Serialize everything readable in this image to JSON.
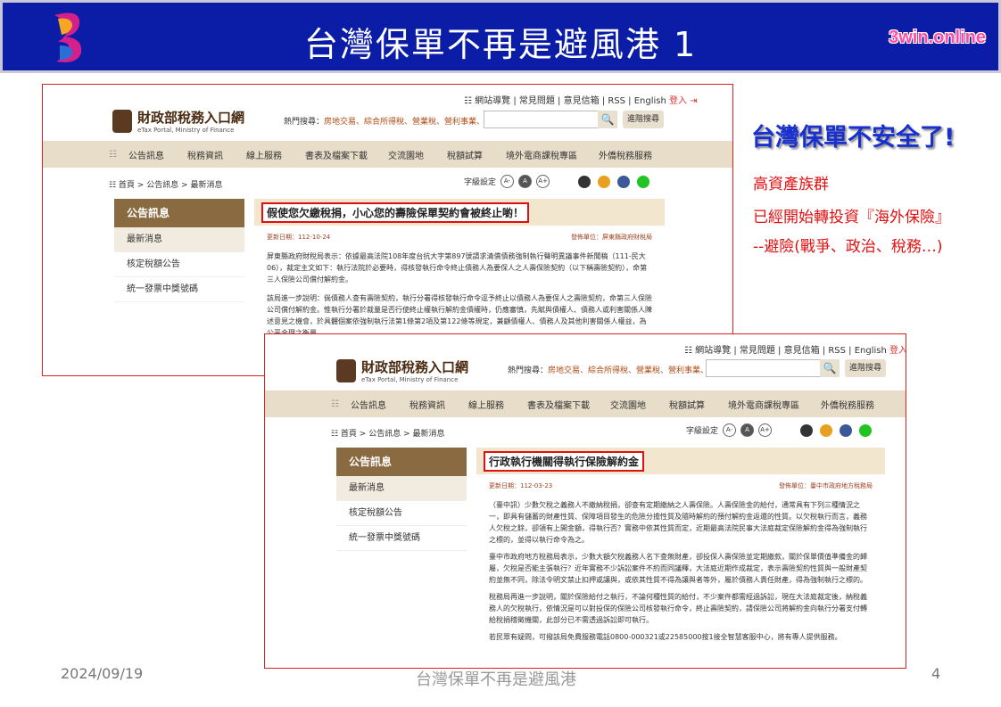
{
  "slide": {
    "title": "台灣保單不再是避風港 1",
    "brand": "3win.online",
    "side_heading": "台灣保單不安全了!",
    "side_lines": [
      "高資產族群",
      "已經開始轉投資『海外保險』",
      "--避險(戰爭、政治、稅務…)"
    ],
    "footer_date": "2024/09/19",
    "footer_title": "台灣保單不再是避風港",
    "footer_page": "4",
    "colors": {
      "banner": "#0b1da6",
      "heading": "#1830d0",
      "accent_red": "#e01010",
      "nav_bg": "#e8ddc8",
      "menu_head": "#8a6a40"
    }
  },
  "portal": {
    "topbar_text": "☷ 網站導覽 | 常見問題 | 意見信箱 | RSS | English ",
    "login": "登入 ⇥",
    "name": "財政部稅務入口網",
    "english_name": "eTax Portal, Ministry of Finance",
    "hot_label": "熱門搜尋：",
    "hot_keywords": "房地交易、綜合所得稅、營業稅、營利事業、退稅",
    "search_icon": "🔍",
    "advanced_search": "進階搜尋",
    "nav": [
      "公告訊息",
      "稅務資訊",
      "線上服務",
      "書表及檔案下載",
      "交流園地",
      "稅額試算",
      "境外電商課稅專區",
      "外僑稅務服務"
    ],
    "breadcrumb": "☷ 首頁 > 公告訊息 > 最新消息",
    "font_label": "字級設定",
    "font_sizes": [
      "A-",
      "A",
      "A+"
    ],
    "menu_title": "公告訊息",
    "menu_items": [
      "最新消息",
      "核定稅額公告",
      "統一發票中獎號碼"
    ]
  },
  "article1": {
    "title": "假使您欠繳稅捐，小心您的壽險保單契約會被終止喲！",
    "date": "更新日期：112-10-24",
    "unit": "發佈單位：屏東縣政府財稅局",
    "p1": "屏東縣政府財稅局表示：依據最高法院108年度台抗大字第897號請求清償債務強制執行聲明異議事件新聞稿（111-民大06），裁定主文如下：執行法院於必要時，得核發執行命令終止債務人為要保人之人壽保險契約（以下稱壽險契約），命第三人保險公司償付解約金。",
    "p2": "該局進一步說明：倘債務人查有壽險契約，執行分署得核發執行命令逕予終止以債務人為要保人之壽險契約，命第三人保險公司償付解約金。惟執行分署於裁量是否行使終止權執行解約金債權時，仍應審慎，先賦與債權人、債務人或利害關係人陳述意見之機會，於具體個案依強制執行法第1條第2項及第122條等規定，兼顧債權人、債務人及其他利害關係人權益，為公平合理之衡量。"
  },
  "article2": {
    "title": "行政執行機關得執行保險解約金",
    "date": "更新日期：112-03-23",
    "unit": "發佈單位：臺中市政府地方稅務局",
    "p1": "（臺中訊）少數欠稅之義務人不繳納稅捐，卻查有定期繳納之人壽保險。人壽保險金的給付，通常具有下列三種情況之一，即具有儲蓄的財產性質、保障項目發生的危險分擔性質及隨時解約的預付解約金返還的性質。以欠稅執行而言，義務人欠稅之餘，卻領有上開金額，得執行否？實務中依其性質而定，近期最高法院民事大法庭裁定保險解約金得為強制執行之標的，並得以執行命令為之。",
    "p2": "臺中市政府地方稅務局表示，少數大額欠稅義務人名下查無財產，卻投保人壽保險並定期繳款，關於保單價值準備金的歸屬，欠稅是否能主張執行？近年實務不少訴訟案件不約而同議釋，大法庭近期作成裁定，表示壽險契約性質與一般財產契約並無不同，除法令明文禁止扣押或讓與，或依其性質不得為讓與者等外，屬於債務人責任財產，得為強制執行之標的。",
    "p3": "稅務局再進一步說明，關於保險給付之執行，不論何種性質的給付，不少案件都需經過訴訟，現在大法庭裁定後，納稅義務人的欠稅執行，依情況是可以對投保的保險公司核發執行命令，終止壽險契約，請保險公司將解約金向執行分署支付轉給稅捐稽徵機關，此部分已不需透過訴訟即可執行。",
    "p4": "若民眾有疑問，可撥該局免費服務電話0800-000321或22585000按1接全智慧客服中心，將有專人提供服務。"
  }
}
